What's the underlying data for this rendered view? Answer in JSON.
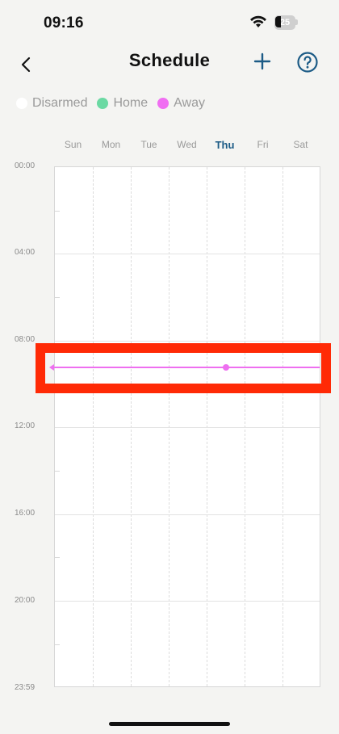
{
  "status_bar": {
    "time": "09:16",
    "battery_level": "25"
  },
  "header": {
    "title": "Schedule"
  },
  "legend": [
    {
      "label": "Disarmed",
      "color": "#ffffff"
    },
    {
      "label": "Home",
      "color": "#6bd9a3"
    },
    {
      "label": "Away",
      "color": "#f06ef2"
    }
  ],
  "days": [
    {
      "label": "Sun"
    },
    {
      "label": "Mon"
    },
    {
      "label": "Tue"
    },
    {
      "label": "Wed"
    },
    {
      "label": "Thu"
    },
    {
      "label": "Fri"
    },
    {
      "label": "Sat"
    }
  ],
  "active_day": "Thu",
  "time_labels": [
    "00:00",
    "04:00",
    "08:00",
    "12:00",
    "16:00",
    "20:00",
    "23:59"
  ],
  "schedule_entry": {
    "mode": "Away",
    "color": "#f06ef2"
  },
  "colors": {
    "accent": "#1c5b86",
    "highlight": "#ff2a06"
  }
}
